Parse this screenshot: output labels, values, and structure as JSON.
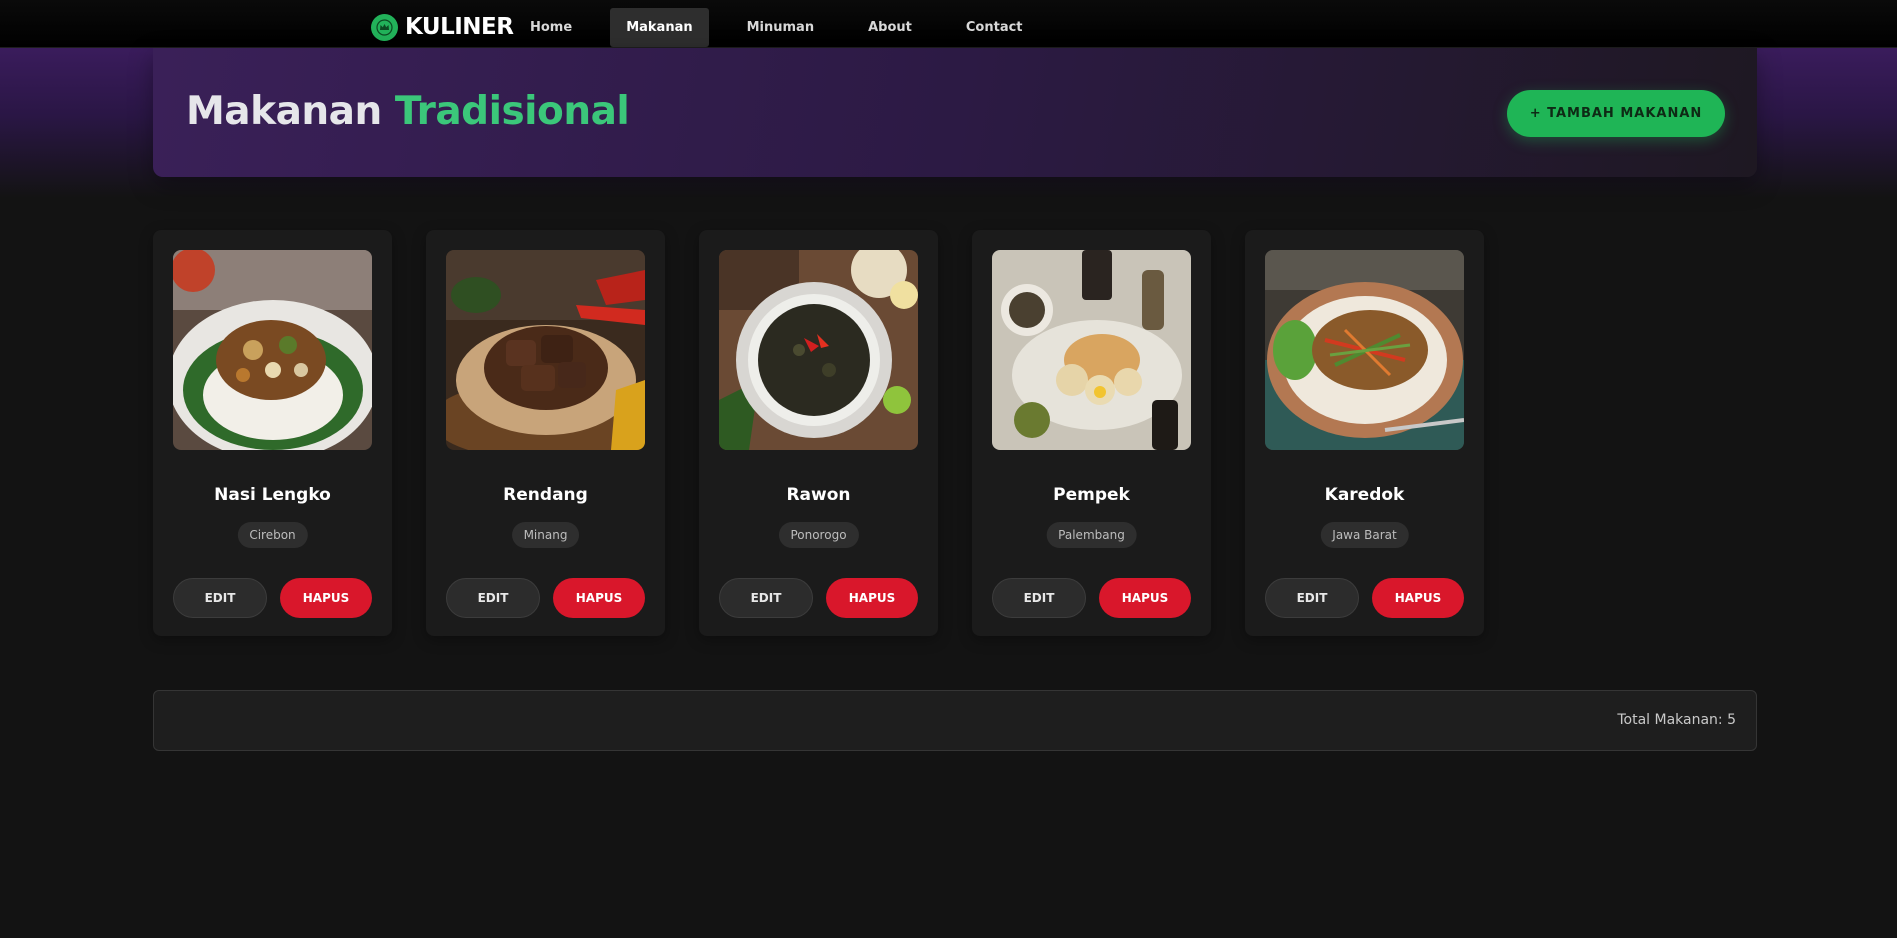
{
  "brand": {
    "name": "KULINER",
    "icon": "crown-badge-icon"
  },
  "nav": [
    {
      "label": "Home",
      "active": false
    },
    {
      "label": "Makanan",
      "active": true
    },
    {
      "label": "Minuman",
      "active": false
    },
    {
      "label": "About",
      "active": false
    },
    {
      "label": "Contact",
      "active": false
    }
  ],
  "hero": {
    "title_part1": "Makanan",
    "title_part2": "Tradisional",
    "add_button": "+ TAMBAH MAKANAN"
  },
  "cards": [
    {
      "name": "Nasi Lengko",
      "region": "Cirebon",
      "edit": "EDIT",
      "delete": "HAPUS",
      "image": "nasi-lengko-photo"
    },
    {
      "name": "Rendang",
      "region": "Minang",
      "edit": "EDIT",
      "delete": "HAPUS",
      "image": "rendang-photo"
    },
    {
      "name": "Rawon",
      "region": "Ponorogo",
      "edit": "EDIT",
      "delete": "HAPUS",
      "image": "rawon-photo"
    },
    {
      "name": "Pempek",
      "region": "Palembang",
      "edit": "EDIT",
      "delete": "HAPUS",
      "image": "pempek-photo"
    },
    {
      "name": "Karedok",
      "region": "Jawa Barat",
      "edit": "EDIT",
      "delete": "HAPUS",
      "image": "karedok-photo"
    }
  ],
  "footer": {
    "total_text": "Total Makanan: 5"
  },
  "colors": {
    "accent_green": "#1fb556",
    "danger_red": "#d9172b",
    "hero_purple": "#3a2058",
    "background": "#131313"
  }
}
